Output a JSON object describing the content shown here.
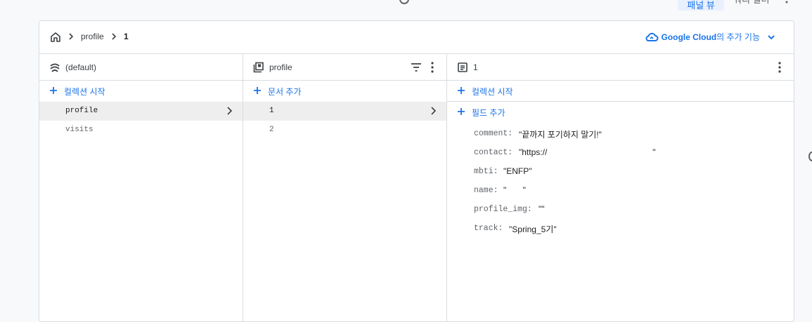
{
  "topbar": {
    "primary_button": "패널 뷰",
    "secondary_text": "쿼리 빌더"
  },
  "breadcrumb": {
    "items": [
      "profile",
      "1"
    ]
  },
  "google_cloud": {
    "brand": "Google Cloud",
    "suffix": "의 추가 기능"
  },
  "columns": [
    {
      "header": "(default)",
      "add_label": "컬렉션 시작",
      "items": [
        {
          "label": "profile",
          "selected": true
        },
        {
          "label": "visits",
          "selected": false
        }
      ]
    },
    {
      "header": "profile",
      "add_label": "문서 추가",
      "items": [
        {
          "label": "1",
          "selected": true
        },
        {
          "label": "2",
          "selected": false
        }
      ]
    },
    {
      "header": "1",
      "add_collection_label": "컬렉션 시작",
      "add_field_label": "필드 추가",
      "fields": [
        {
          "key": "comment:",
          "value": "\"끝까지 포기하지 말기!\""
        },
        {
          "key": "contact:",
          "value": "\"https://                                             \""
        },
        {
          "key": "mbti:",
          "value": "\"ENFP\""
        },
        {
          "key": "name:",
          "value": "\"       \""
        },
        {
          "key": "profile_img:",
          "value": "\"\""
        },
        {
          "key": "track:",
          "value": "\"Spring_5기\""
        }
      ]
    }
  ],
  "colors": {
    "accent": "#1a73e8",
    "border": "#dadce0",
    "selected_bg": "#eeeeee"
  },
  "icons": [
    "home-icon",
    "chevron-right-icon",
    "cloud-icon",
    "chevron-down-icon",
    "database-icon",
    "collection-icon",
    "document-icon",
    "filter-icon",
    "more-vert-icon",
    "plus-icon"
  ]
}
